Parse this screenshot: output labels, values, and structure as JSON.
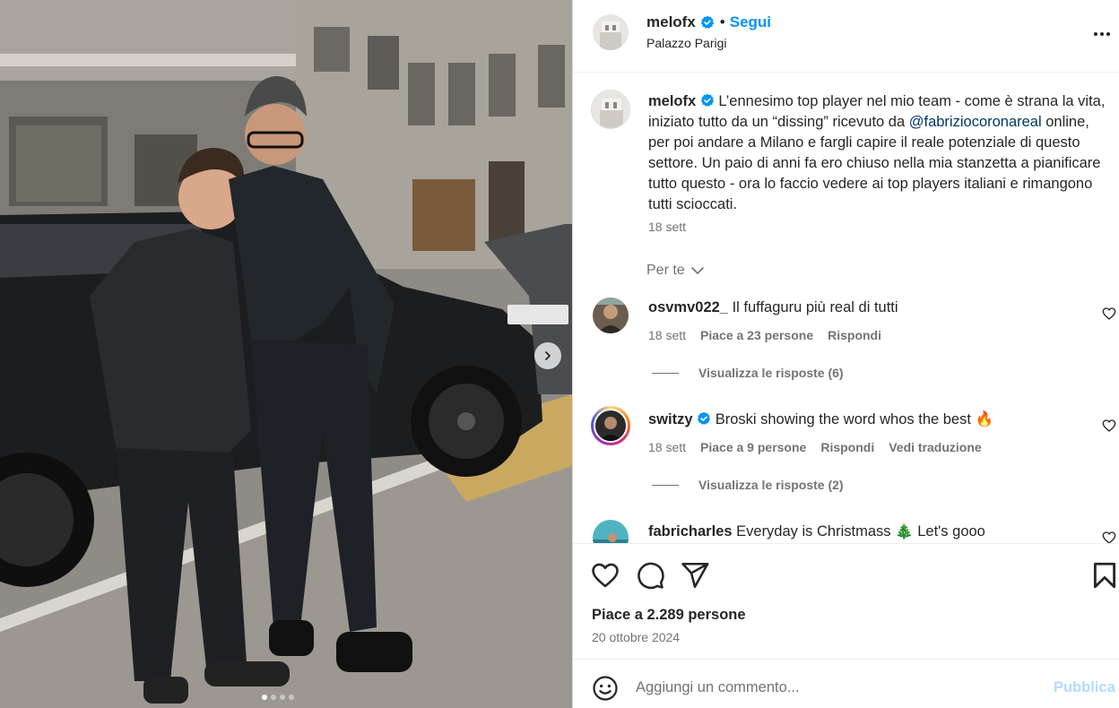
{
  "post": {
    "username": "melofx",
    "follow_label": "Segui",
    "separator": "•",
    "location": "Palazzo Parigi",
    "caption_username": "melofx",
    "caption_before_mention": " L’ennesimo top player nel mio team - come è strana la vita, iniziato tutto da un “dissing” ricevuto da ",
    "caption_mention": "@fabriziocoronareal",
    "caption_after_mention": " online, per poi andare a Milano e fargli capire il reale potenziale di questo settore. Un paio di anni fa ero chiuso nella mia stanzetta a pianificare tutto questo - ora lo faccio vedere ai top players italiani e rimangono tutti scioccati.",
    "caption_time": "18 sett",
    "for_you_label": "Per te",
    "likes": "Piace a 2.289 persone",
    "date": "20 ottobre 2024",
    "add_comment_placeholder": "Aggiungi un commento...",
    "publish_label": "Pubblica",
    "carousel_slides": 4,
    "carousel_active": 1
  },
  "comments": [
    {
      "username": "osvmv022_",
      "text": " Il fuffaguru più real di tutti",
      "time": "18 sett",
      "likes": "Piace a 23 persone",
      "reply": "Rispondi",
      "view_replies": "Visualizza le risposte (6)"
    },
    {
      "username": "switzy",
      "text": " Broski showing the word whos the best 🔥",
      "time": "18 sett",
      "likes": "Piace a 9 persone",
      "reply": "Rispondi",
      "translate": "Vedi traduzione",
      "view_replies": "Visualizza le risposte (2)"
    },
    {
      "username": "fabricharles",
      "text": " Everyday is Christmass 🎄 Let's gooo"
    }
  ],
  "colors": {
    "accent": "#0095f6",
    "mention": "#00376b",
    "muted": "#737373",
    "publish_disabled": "#b3dbff",
    "verified": "#0095f6"
  },
  "icons": [
    "verified-badge-icon",
    "more-options-icon",
    "chevron-down-icon",
    "heart-icon",
    "comment-icon",
    "share-icon",
    "bookmark-icon",
    "emoji-icon",
    "chevron-right-icon"
  ]
}
